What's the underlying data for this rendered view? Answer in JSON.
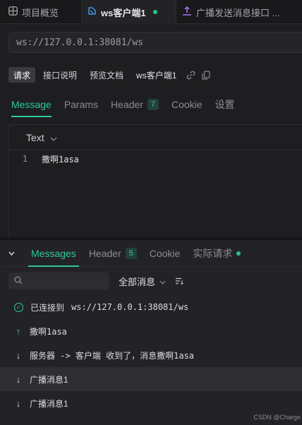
{
  "tabs": [
    {
      "label": "项目概览",
      "icon": "grid-icon"
    },
    {
      "label": "ws客户端1",
      "icon": "websocket-icon",
      "active": true
    },
    {
      "label": "广播发送消息接口 ...",
      "icon": "api-icon"
    }
  ],
  "url": {
    "value": "ws://127.0.0.1:38081/ws"
  },
  "subtabs": {
    "request": "请求",
    "api_doc": "接口说明",
    "preview_doc": "预览文档",
    "name": "ws客户端1"
  },
  "request_tabs": {
    "message": "Message",
    "params": "Params",
    "header": "Header",
    "header_count": "7",
    "cookie": "Cookie",
    "settings": "设置"
  },
  "editor": {
    "format": "Text",
    "lines": [
      {
        "num": "1",
        "text": "撒啊1asa"
      }
    ]
  },
  "response_tabs": {
    "messages": "Messages",
    "header": "Header",
    "header_count": "5",
    "cookie": "Cookie",
    "actual_request": "实际请求"
  },
  "filter": {
    "search_placeholder": "",
    "selected": "全部消息"
  },
  "messages": [
    {
      "type": "connected",
      "icon": "check-circle-icon",
      "label": "已连接到",
      "text": "ws://127.0.0.1:38081/ws"
    },
    {
      "type": "sent",
      "icon": "arrow-up-icon",
      "text": "撒啊1asa"
    },
    {
      "type": "received",
      "icon": "arrow-down-icon",
      "text": "服务器 -> 客户端 收到了，消息撒啊1asa"
    },
    {
      "type": "received",
      "icon": "arrow-down-icon",
      "text": "广播消息1"
    },
    {
      "type": "received",
      "icon": "arrow-down-icon",
      "text": "广播消息1"
    }
  ],
  "watermark": "CSDN @Charge",
  "colors": {
    "accent": "#2fc79b",
    "background": "#1e1e20"
  }
}
